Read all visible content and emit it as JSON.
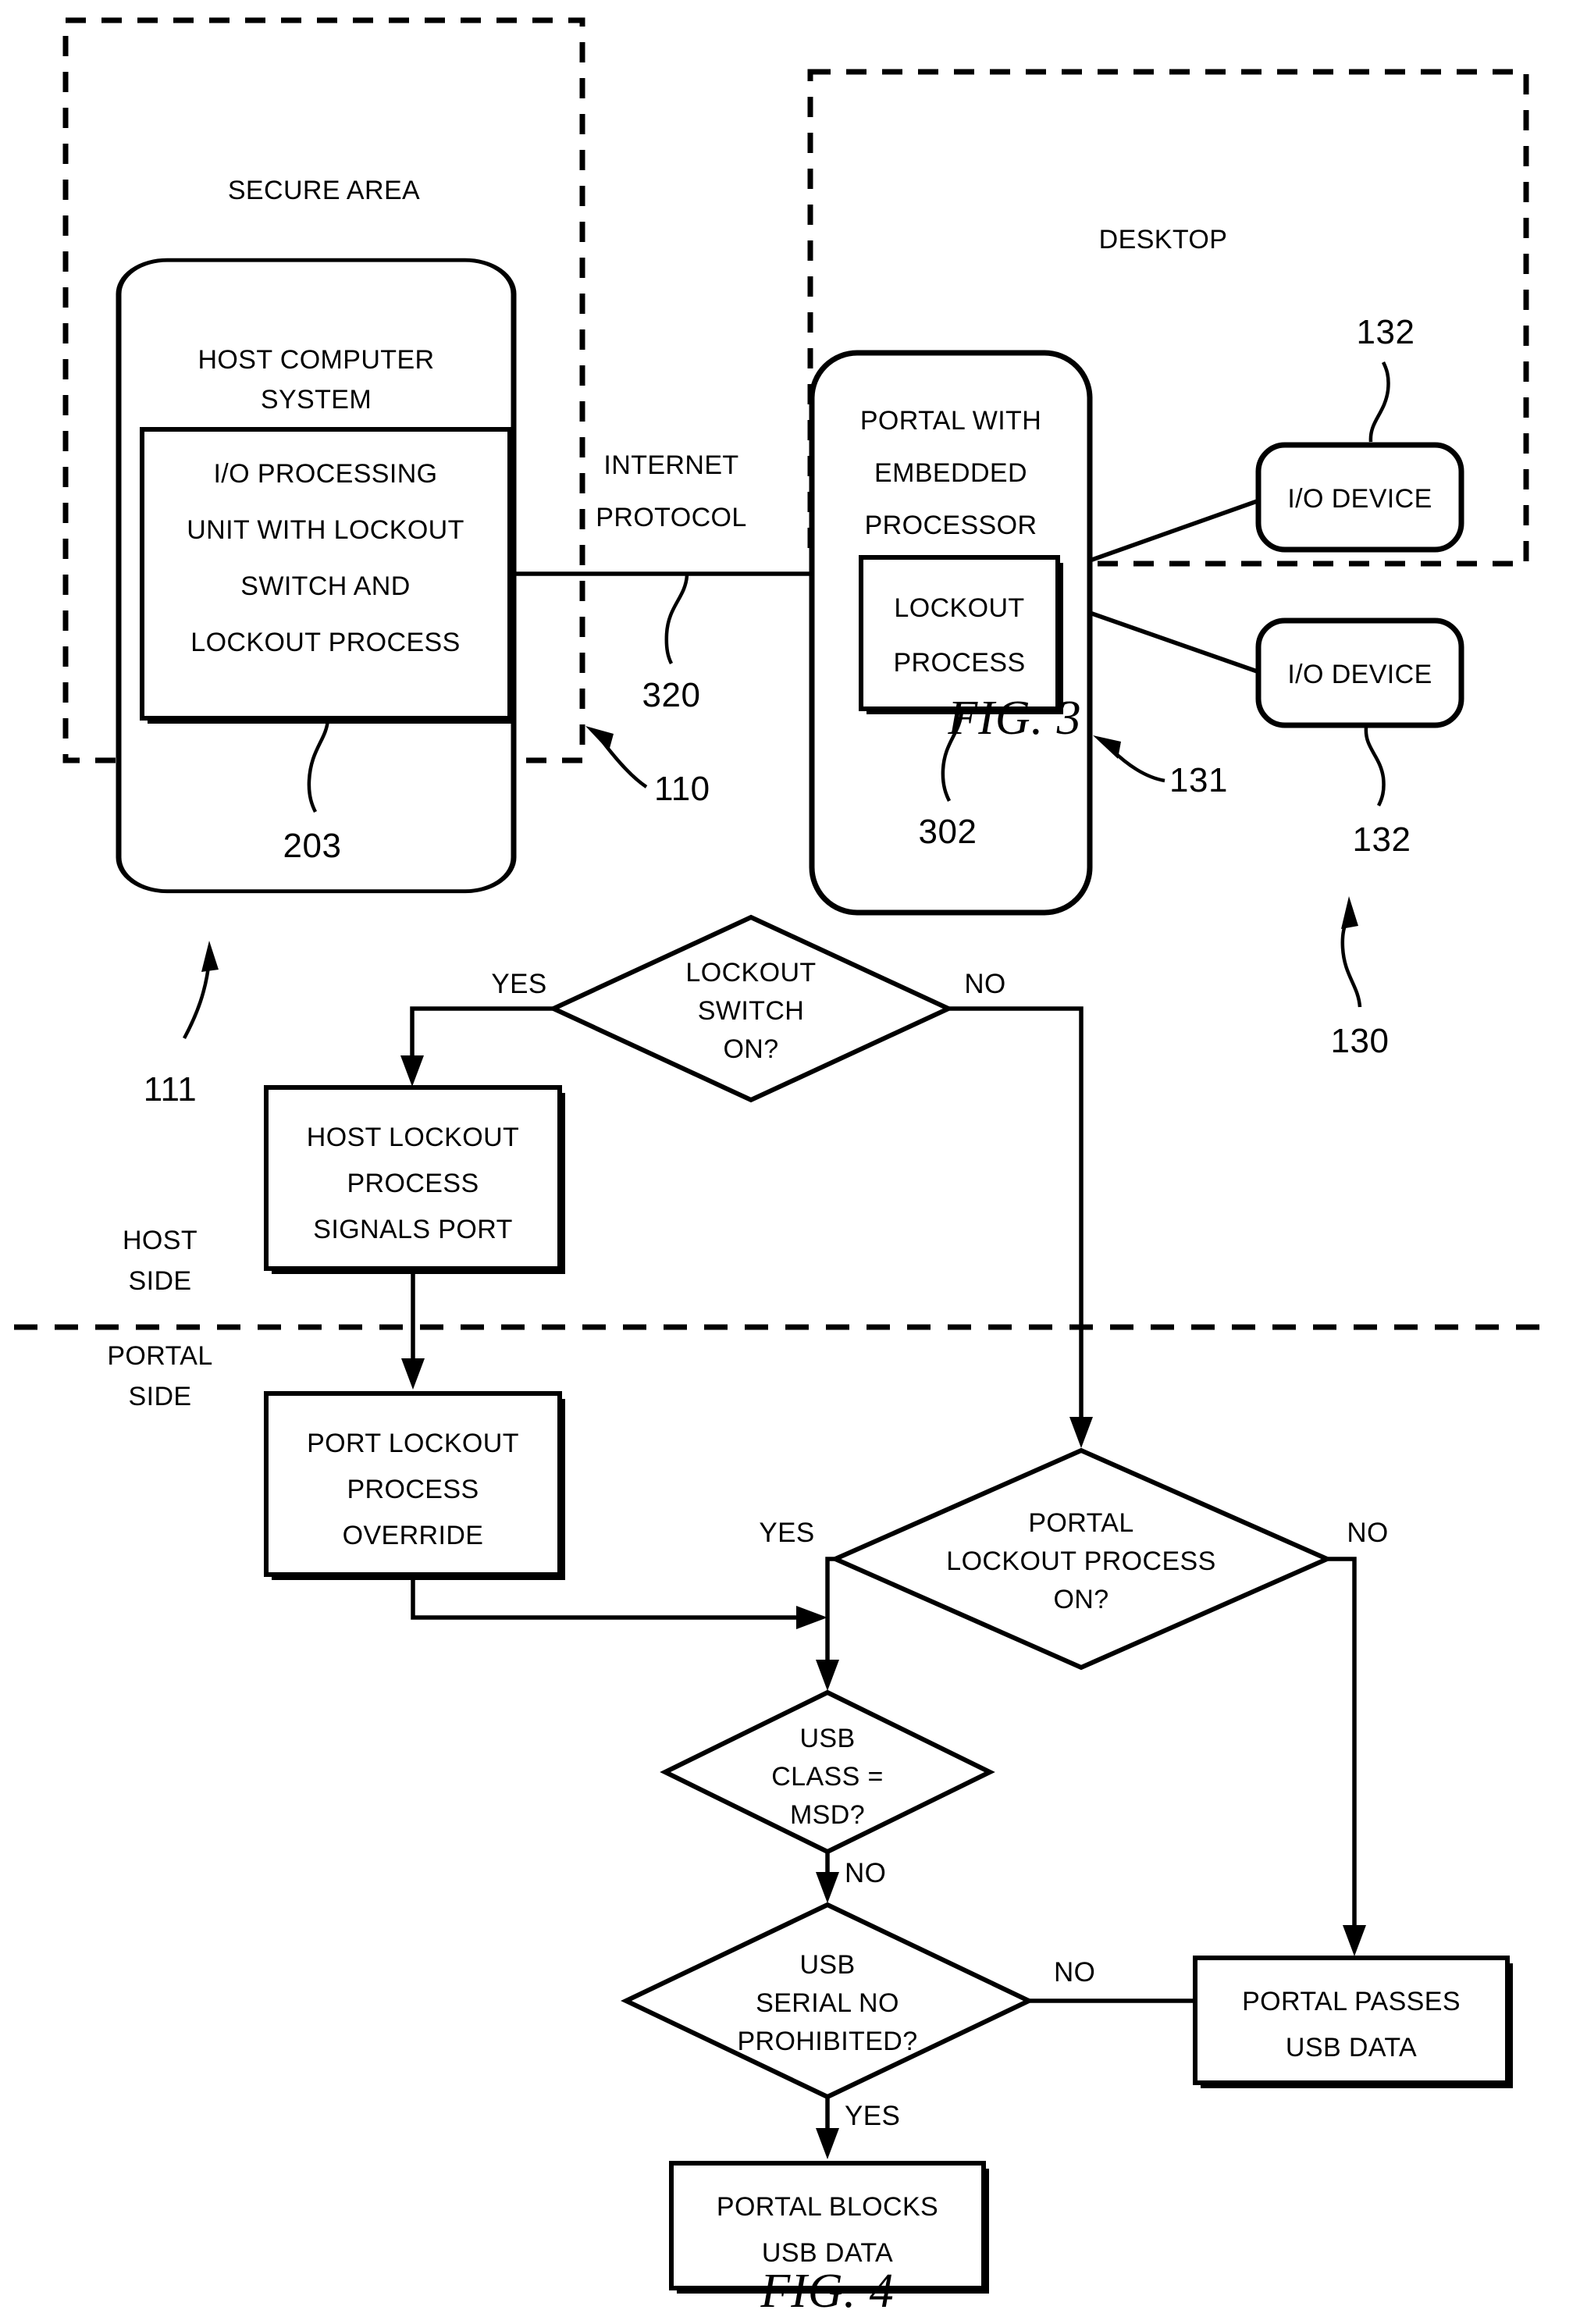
{
  "sheet": {
    "figures": [
      {
        "id": "fig3",
        "caption": "FIG. 3",
        "regions": [
          {
            "name": "secure-area",
            "label": "SECURE AREA"
          },
          {
            "name": "desktop",
            "label": "DESKTOP"
          }
        ],
        "nodes": [
          {
            "name": "host-computer-system",
            "lines": [
              "HOST COMPUTER",
              "SYSTEM"
            ]
          },
          {
            "name": "io-processing-unit",
            "lines": [
              "I/O PROCESSING",
              "UNIT WITH LOCKOUT",
              "SWITCH AND",
              "LOCKOUT PROCESS"
            ]
          },
          {
            "name": "portal-embedded-processor",
            "lines": [
              "PORTAL WITH",
              "EMBEDDED",
              "PROCESSOR"
            ]
          },
          {
            "name": "lockout-process",
            "lines": [
              "LOCKOUT",
              "PROCESS"
            ]
          },
          {
            "name": "io-device-top",
            "lines": [
              "I/O DEVICE"
            ]
          },
          {
            "name": "io-device-bottom",
            "lines": [
              "I/O DEVICE"
            ]
          }
        ],
        "connections": [
          {
            "name": "internet-protocol-link",
            "lines": [
              "INTERNET",
              "PROTOCOL"
            ]
          }
        ],
        "reference_numerals": [
          {
            "name": "ref-203",
            "value": "203"
          },
          {
            "name": "ref-320",
            "value": "320"
          },
          {
            "name": "ref-302",
            "value": "302"
          },
          {
            "name": "ref-131",
            "value": "131"
          },
          {
            "name": "ref-132-top",
            "value": "132"
          },
          {
            "name": "ref-132-bottom",
            "value": "132"
          },
          {
            "name": "ref-130",
            "value": "130"
          },
          {
            "name": "ref-110",
            "value": "110"
          },
          {
            "name": "ref-111",
            "value": "111"
          }
        ]
      },
      {
        "id": "fig4",
        "caption": "FIG. 4",
        "swimlanes": [
          {
            "name": "host-side",
            "lines": [
              "HOST",
              "SIDE"
            ]
          },
          {
            "name": "portal-side",
            "lines": [
              "PORTAL",
              "SIDE"
            ]
          }
        ],
        "decisions": [
          {
            "name": "lockout-switch-on",
            "lines": [
              "LOCKOUT",
              "SWITCH",
              "ON?"
            ]
          },
          {
            "name": "portal-lockout-process-on",
            "lines": [
              "PORTAL",
              "LOCKOUT PROCESS",
              "ON?"
            ]
          },
          {
            "name": "usb-class-msd",
            "lines": [
              "USB",
              "CLASS =",
              "MSD?"
            ]
          },
          {
            "name": "usb-serial-no-prohibited",
            "lines": [
              "USB",
              "SERIAL NO",
              "PROHIBITED?"
            ]
          }
        ],
        "processes": [
          {
            "name": "host-lockout-process-signals-port",
            "lines": [
              "HOST LOCKOUT",
              "PROCESS",
              "SIGNALS PORT"
            ]
          },
          {
            "name": "port-lockout-process-override",
            "lines": [
              "PORT LOCKOUT",
              "PROCESS",
              "OVERRIDE"
            ]
          },
          {
            "name": "portal-passes-usb-data",
            "lines": [
              "PORTAL PASSES",
              "USB DATA"
            ]
          },
          {
            "name": "portal-blocks-usb-data",
            "lines": [
              "PORTAL BLOCKS",
              "USB DATA"
            ]
          }
        ],
        "edge_labels": [
          {
            "name": "edge-lockout-switch-yes",
            "value": "YES"
          },
          {
            "name": "edge-lockout-switch-no",
            "value": "NO"
          },
          {
            "name": "edge-portal-lockout-yes",
            "value": "YES"
          },
          {
            "name": "edge-portal-lockout-no",
            "value": "NO"
          },
          {
            "name": "edge-usb-class-no",
            "value": "NO"
          },
          {
            "name": "edge-usb-serial-no",
            "value": "NO"
          },
          {
            "name": "edge-usb-serial-yes",
            "value": "YES"
          }
        ]
      }
    ]
  },
  "fig3": {
    "caption": "FIG. 3",
    "secure_area_label": "SECURE AREA",
    "desktop_label": "DESKTOP",
    "host_computer_system": {
      "l1": "HOST COMPUTER",
      "l2": "SYSTEM"
    },
    "io_processing_unit": {
      "l1": "I/O PROCESSING",
      "l2": "UNIT WITH LOCKOUT",
      "l3": "SWITCH AND",
      "l4": "LOCKOUT PROCESS"
    },
    "portal": {
      "l1": "PORTAL WITH",
      "l2": "EMBEDDED",
      "l3": "PROCESSOR"
    },
    "lockout_process": {
      "l1": "LOCKOUT",
      "l2": "PROCESS"
    },
    "internet_protocol": {
      "l1": "INTERNET",
      "l2": "PROTOCOL"
    },
    "io_device_top": "I/O DEVICE",
    "io_device_bottom": "I/O DEVICE",
    "refs": {
      "r203": "203",
      "r320": "320",
      "r302": "302",
      "r131": "131",
      "r132_top": "132",
      "r132_bottom": "132",
      "r130": "130",
      "r110": "110",
      "r111": "111"
    }
  },
  "fig4": {
    "caption": "FIG. 4",
    "host_side": {
      "l1": "HOST",
      "l2": "SIDE"
    },
    "portal_side": {
      "l1": "PORTAL",
      "l2": "SIDE"
    },
    "d_lockout_switch": {
      "l1": "LOCKOUT",
      "l2": "SWITCH",
      "l3": "ON?"
    },
    "p_host_lockout": {
      "l1": "HOST LOCKOUT",
      "l2": "PROCESS",
      "l3": "SIGNALS PORT"
    },
    "p_port_lockout": {
      "l1": "PORT LOCKOUT",
      "l2": "PROCESS",
      "l3": "OVERRIDE"
    },
    "d_portal_lockout": {
      "l1": "PORTAL",
      "l2": "LOCKOUT PROCESS",
      "l3": "ON?"
    },
    "d_usb_class": {
      "l1": "USB",
      "l2": "CLASS =",
      "l3": "MSD?"
    },
    "d_usb_serial": {
      "l1": "USB",
      "l2": "SERIAL NO",
      "l3": "PROHIBITED?"
    },
    "p_portal_passes": {
      "l1": "PORTAL PASSES",
      "l2": "USB DATA"
    },
    "p_portal_blocks": {
      "l1": "PORTAL BLOCKS",
      "l2": "USB DATA"
    },
    "labels": {
      "yes_switch": "YES",
      "no_switch": "NO",
      "yes_portal": "YES",
      "no_portal": "NO",
      "no_class": "NO",
      "no_serial": "NO",
      "yes_serial": "YES"
    }
  }
}
